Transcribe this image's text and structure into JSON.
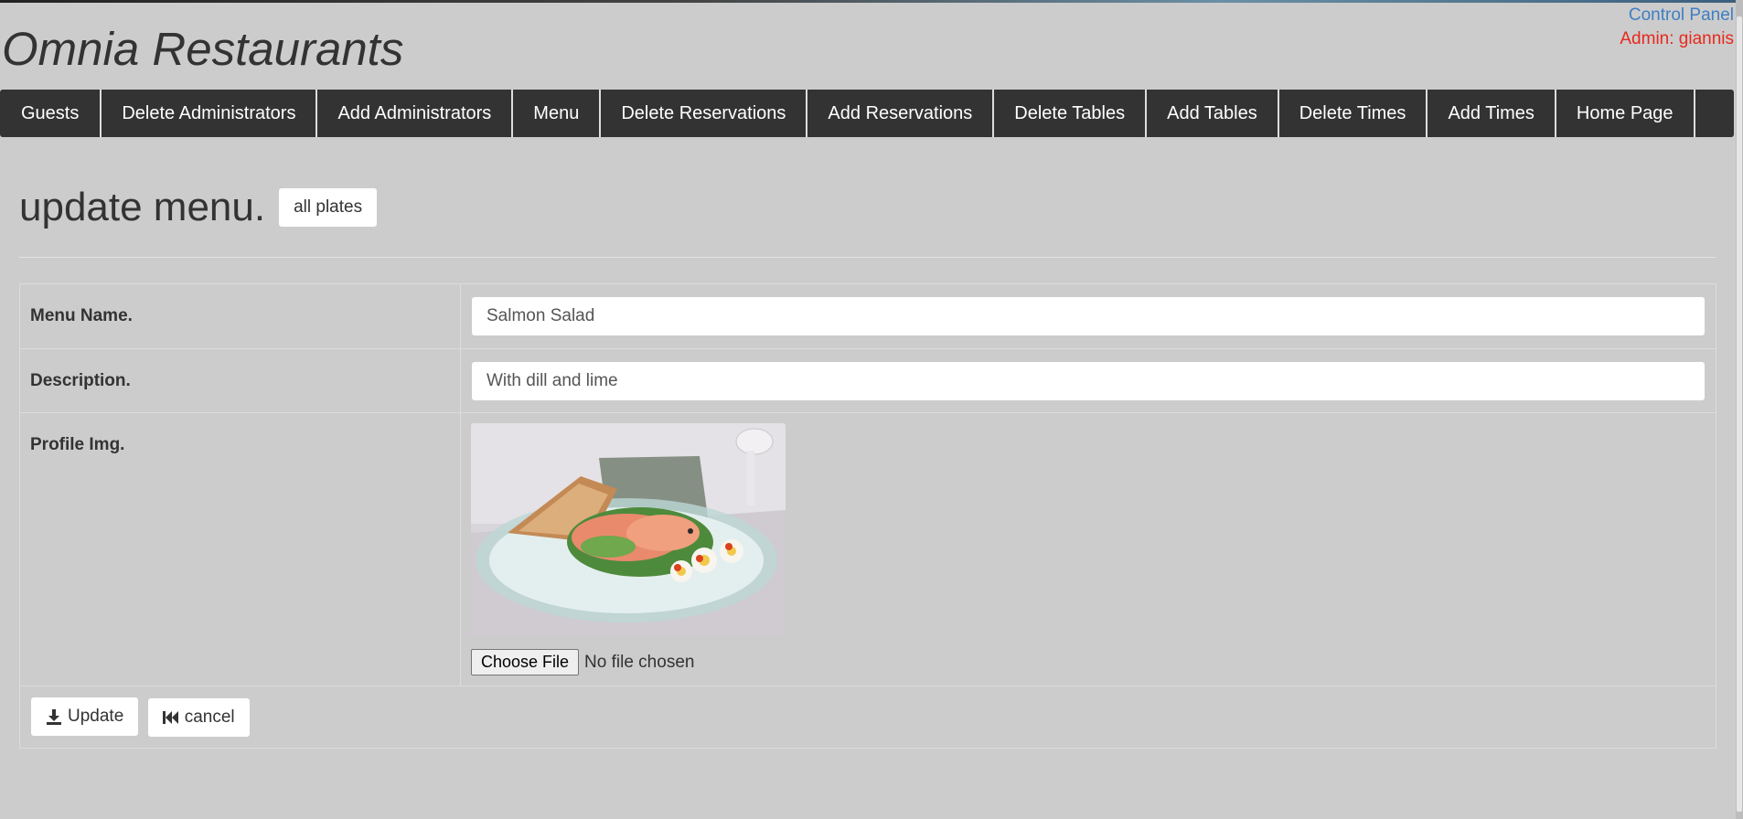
{
  "header": {
    "site_title": "Omnia Restaurants",
    "control_panel": "Control Panel",
    "admin_label": "Admin: giannis"
  },
  "nav": {
    "items": [
      {
        "label": "Guests"
      },
      {
        "label": "Delete Administrators"
      },
      {
        "label": "Add Administrators"
      },
      {
        "label": "Menu"
      },
      {
        "label": "Delete Reservations"
      },
      {
        "label": "Add Reservations"
      },
      {
        "label": "Delete Tables"
      },
      {
        "label": "Add Tables"
      },
      {
        "label": "Delete Times"
      },
      {
        "label": "Add Times"
      },
      {
        "label": "Home Page"
      }
    ]
  },
  "page": {
    "heading": "update menu.",
    "all_plates_label": "all plates"
  },
  "form": {
    "menu_name_label": "Menu Name.",
    "menu_name_value": "Salmon Salad",
    "description_label": "Description.",
    "description_value": "With dill and lime",
    "profile_img_label": "Profile Img.",
    "choose_file_label": "Choose File",
    "no_file_text": "No file chosen",
    "update_label": "Update",
    "cancel_label": "cancel"
  },
  "colors": {
    "background": "#cccccc",
    "navbar": "#333333",
    "link_blue": "#3f7fc2",
    "admin_red": "#e8291c"
  }
}
